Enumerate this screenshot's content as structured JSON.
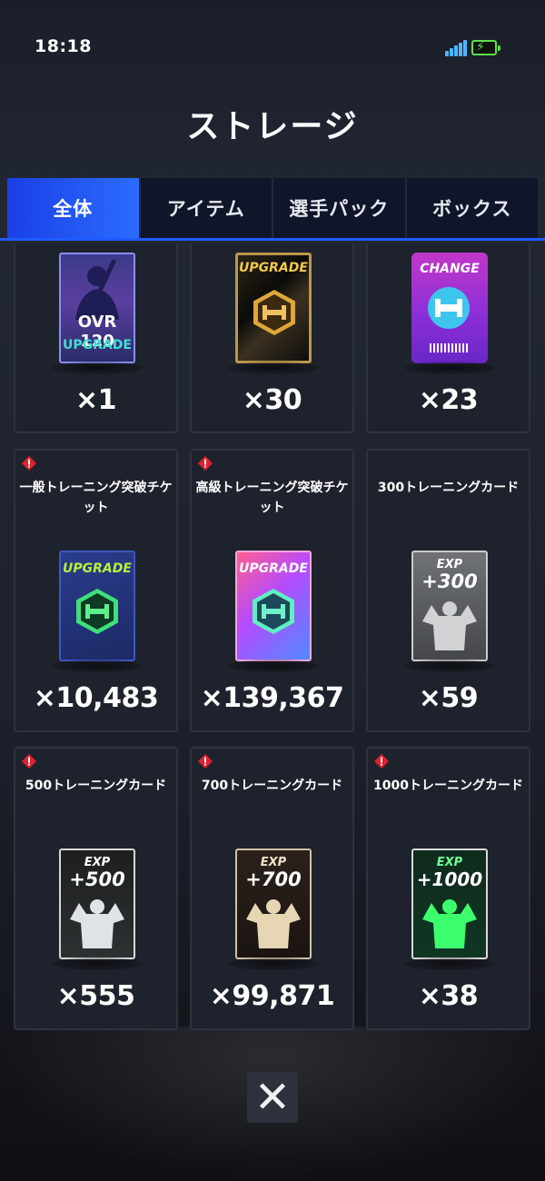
{
  "status_bar": {
    "time": "18:18"
  },
  "page": {
    "title": "ストレージ"
  },
  "tabs": [
    {
      "label": "全体",
      "active": true
    },
    {
      "label": "アイテム",
      "active": false
    },
    {
      "label": "選手パック",
      "active": false
    },
    {
      "label": "ボックス",
      "active": false
    }
  ],
  "items": [
    {
      "name": "",
      "qty": "×1",
      "card_text": [
        "OVR 120",
        "UPGRADE"
      ],
      "icon": "batter-silhouette-icon",
      "warn": false
    },
    {
      "name": "",
      "qty": "×30",
      "card_text": [
        "UPGRADE"
      ],
      "icon": "dumbbell-icon",
      "warn": false
    },
    {
      "name": "",
      "qty": "×23",
      "card_text": [
        "CHANGE"
      ],
      "icon": "exchange-icon",
      "warn": false
    },
    {
      "name": "一般トレーニング突破チケット",
      "qty": "×10,483",
      "card_text": [
        "UPGRADE"
      ],
      "icon": "dumbbell-icon",
      "warn": true
    },
    {
      "name": "高級トレーニング突破チケット",
      "qty": "×139,367",
      "card_text": [
        "UPGRADE"
      ],
      "icon": "dumbbell-icon",
      "warn": true
    },
    {
      "name": "300トレーニングカード",
      "qty": "×59",
      "card_text": [
        "EXP",
        "+300"
      ],
      "icon": "muscle-silhouette-icon",
      "warn": false
    },
    {
      "name": "500トレーニングカード",
      "qty": "×555",
      "card_text": [
        "EXP",
        "+500"
      ],
      "icon": "muscle-silhouette-icon",
      "warn": true
    },
    {
      "name": "700トレーニングカード",
      "qty": "×99,871",
      "card_text": [
        "EXP",
        "+700"
      ],
      "icon": "muscle-silhouette-icon",
      "warn": true
    },
    {
      "name": "1000トレーニングカード",
      "qty": "×38",
      "card_text": [
        "EXP",
        "+1000"
      ],
      "icon": "muscle-silhouette-icon",
      "warn": true
    }
  ],
  "close": {
    "label": "✕"
  },
  "colors": {
    "accent": "#2b6cff",
    "card_bg": "#1e222c",
    "warning": "#e0202c"
  }
}
